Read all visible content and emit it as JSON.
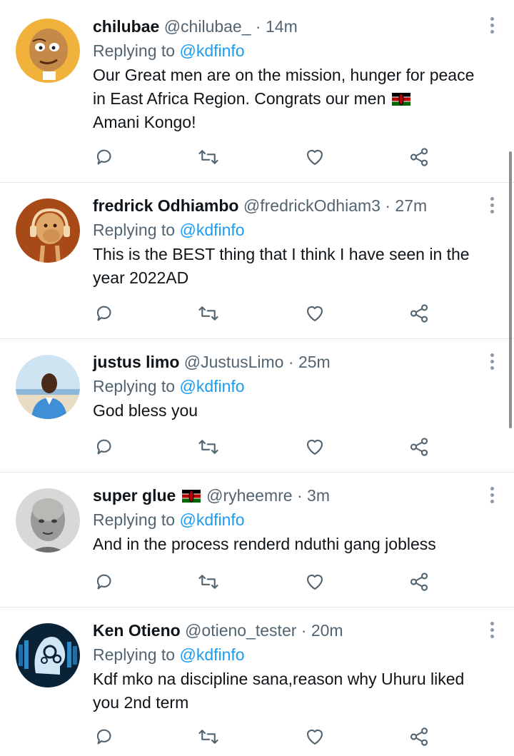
{
  "tweets": [
    {
      "name": "chilubae",
      "handle": "@chilubae_",
      "time": "14m",
      "replying_prefix": "Replying to ",
      "mention": "@kdfinfo",
      "text_before_flag": "Our Great men are on the mission, hunger for peace in East Africa Region. Congrats our men",
      "text_after_flag": "Amani Kongo!",
      "avatar": "cartoon-face-avatar",
      "flag": "kenya-flag-icon"
    },
    {
      "name": "fredrick Odhiambo",
      "handle": "@fredrickOdhiam3",
      "time": "27m",
      "replying_prefix": "Replying to ",
      "mention": "@kdfinfo",
      "text": "This is the BEST thing that I think I have seen in the year 2022AD",
      "avatar": "ape-headphones-avatar"
    },
    {
      "name": "justus limo",
      "handle": "@JustusLimo",
      "time": "25m",
      "replying_prefix": "Replying to ",
      "mention": "@kdfinfo",
      "text": "God bless you",
      "avatar": "beach-portrait-avatar"
    },
    {
      "name": "super glue",
      "handle": "@ryheemre",
      "time": "3m",
      "replying_prefix": "Replying to ",
      "mention": "@kdfinfo",
      "text": "And in the process renderd nduthi gang jobless",
      "avatar": "dusty-face-avatar",
      "name_flag": "kenya-flag-icon"
    },
    {
      "name": "Ken Otieno",
      "handle": "@otieno_tester",
      "time": "20m",
      "replying_prefix": "Replying to ",
      "mention": "@kdfinfo",
      "text": "Kdf mko na discipline sana,reason why Uhuru liked you 2nd term",
      "avatar": "tech-head-avatar"
    }
  ],
  "separator": "·",
  "icons": [
    "reply-icon",
    "retweet-icon",
    "like-icon",
    "share-icon",
    "more-options-icon"
  ],
  "colors": {
    "mention": "#1d9bf0",
    "muted": "#536471",
    "text": "#0f1419",
    "divider": "#e4e8ec"
  }
}
